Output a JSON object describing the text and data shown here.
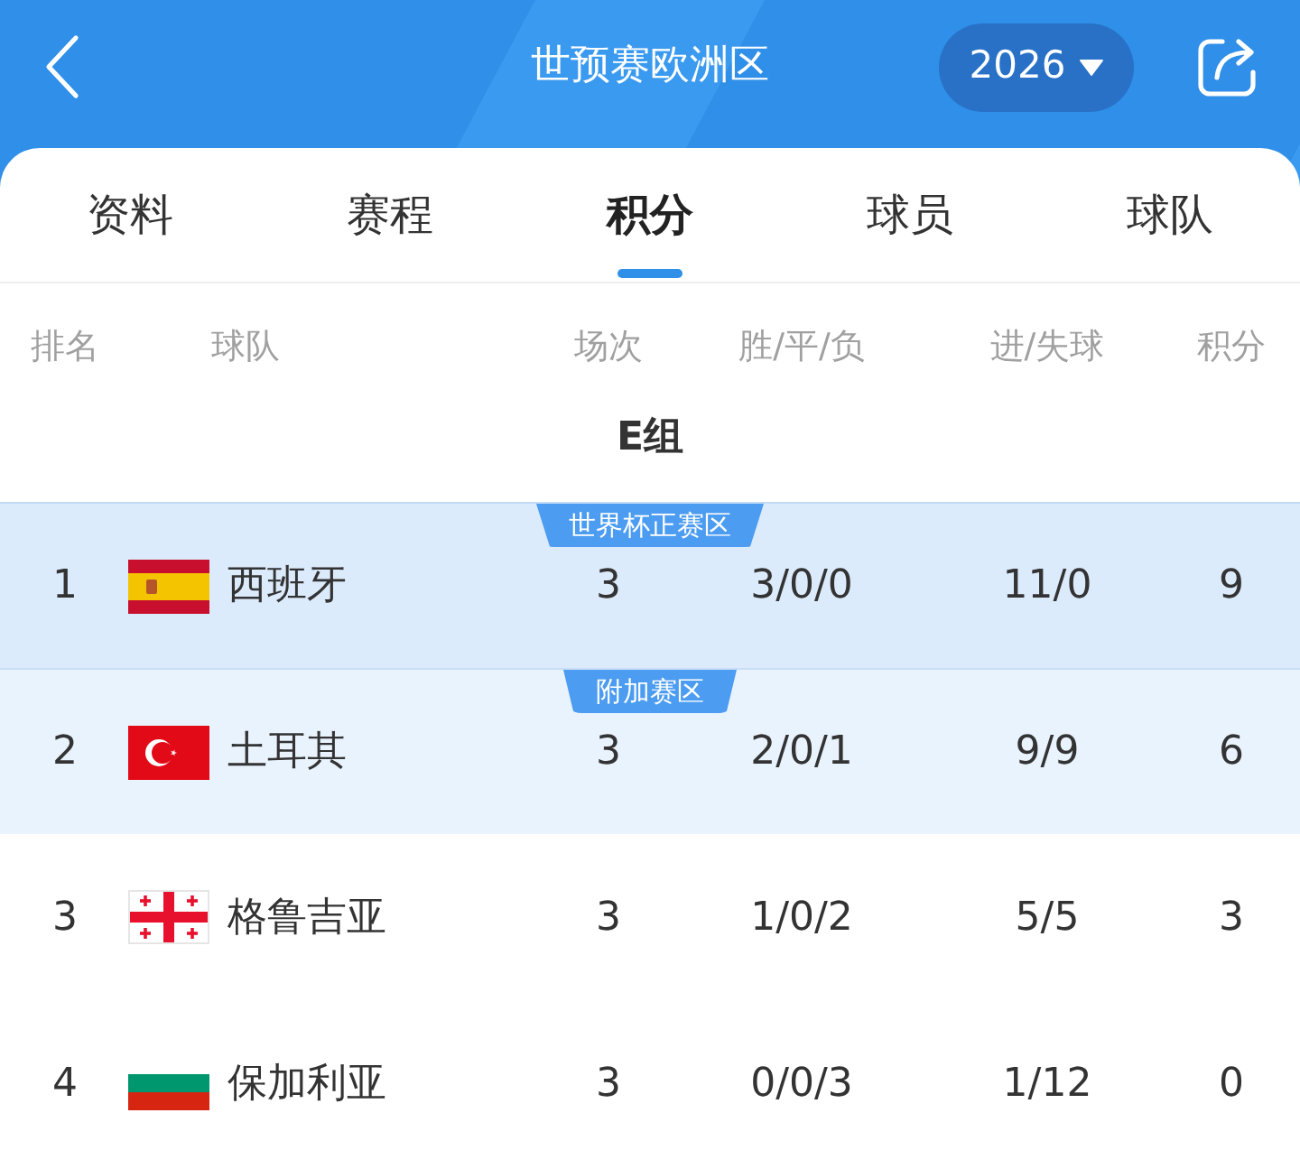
{
  "header": {
    "title": "世预赛欧洲区",
    "season": "2026"
  },
  "tabs": [
    {
      "label": "资料",
      "selected": false
    },
    {
      "label": "赛程",
      "selected": false
    },
    {
      "label": "积分",
      "selected": true
    },
    {
      "label": "球员",
      "selected": false
    },
    {
      "label": "球队",
      "selected": false
    }
  ],
  "table": {
    "columns": [
      "排名",
      "球队",
      "场次",
      "胜/平/负",
      "进/失球",
      "积分"
    ],
    "group": "E组",
    "rows": [
      {
        "rank": "1",
        "flag": {
          "kind": "spain"
        },
        "team": "西班牙",
        "played": "3",
        "record": "3/0/0",
        "goals": "11/0",
        "points": "9",
        "zone": {
          "kind": "qualify",
          "label": "世界杯正赛区"
        }
      },
      {
        "rank": "2",
        "flag": {
          "kind": "turkey"
        },
        "team": "土耳其",
        "played": "3",
        "record": "2/0/1",
        "goals": "9/9",
        "points": "6",
        "zone": {
          "kind": "playoff",
          "label": "附加赛区"
        }
      },
      {
        "rank": "3",
        "flag": {
          "kind": "georgia"
        },
        "team": "格鲁吉亚",
        "played": "3",
        "record": "1/0/2",
        "goals": "5/5",
        "points": "3"
      },
      {
        "rank": "4",
        "flag": {
          "kind": "bulgaria"
        },
        "team": "保加利亚",
        "played": "3",
        "record": "0/0/3",
        "goals": "1/12",
        "points": "0"
      }
    ]
  }
}
